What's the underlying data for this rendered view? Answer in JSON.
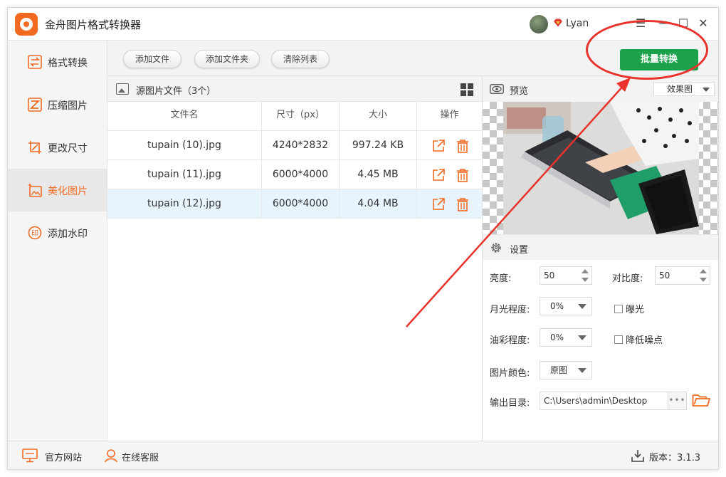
{
  "app": {
    "title": "金舟图片格式转换器",
    "username": "Lyan"
  },
  "window_controls": {
    "menu": "☰",
    "minimize": "—",
    "maximize": "☐",
    "close": "✕"
  },
  "sidebar": {
    "items": [
      {
        "label": "格式转换",
        "icon": "format-convert-icon",
        "active": false
      },
      {
        "label": "压缩图片",
        "icon": "compress-icon",
        "active": false
      },
      {
        "label": "更改尺寸",
        "icon": "resize-icon",
        "active": false
      },
      {
        "label": "美化图片",
        "icon": "beautify-icon",
        "active": true
      },
      {
        "label": "添加水印",
        "icon": "watermark-icon",
        "active": false
      }
    ]
  },
  "toolbar": {
    "add_file": "添加文件",
    "add_folder": "添加文件夹",
    "clear_list": "清除列表",
    "batch_convert": "批量转换"
  },
  "files": {
    "title": "源图片文件（3个）",
    "columns": [
      "文件名",
      "尺寸（px）",
      "大小",
      "操作"
    ],
    "rows": [
      {
        "name": "tupain (10).jpg",
        "size": "4240*2832",
        "filesize": "997.24 KB",
        "selected": false
      },
      {
        "name": "tupain (11).jpg",
        "size": "6000*4000",
        "filesize": "4.45 MB",
        "selected": false
      },
      {
        "name": "tupain (12).jpg",
        "size": "6000*4000",
        "filesize": "4.04 MB",
        "selected": true
      }
    ]
  },
  "preview": {
    "label": "预览",
    "mode": "效果图"
  },
  "settings": {
    "label": "设置",
    "brightness_label": "亮度:",
    "brightness": "50",
    "contrast_label": "对比度:",
    "contrast": "50",
    "moonlight_label": "月光程度:",
    "moonlight": "0%",
    "exposure_label": "曝光",
    "oil_label": "油彩程度:",
    "oil": "0%",
    "denoise_label": "降低噪点",
    "color_label": "图片颜色:",
    "color": "原图",
    "output_label": "输出目录:",
    "output_path": "C:\\Users\\admin\\Desktop",
    "more": "•••"
  },
  "statusbar": {
    "website": "官方网站",
    "support": "在线客服",
    "version": "版本：3.1.3"
  },
  "colors": {
    "accent": "#f26a21",
    "batch_button": "#1ba24a",
    "annotation": "#e8322b",
    "selected_row": "#e8f4fd"
  }
}
